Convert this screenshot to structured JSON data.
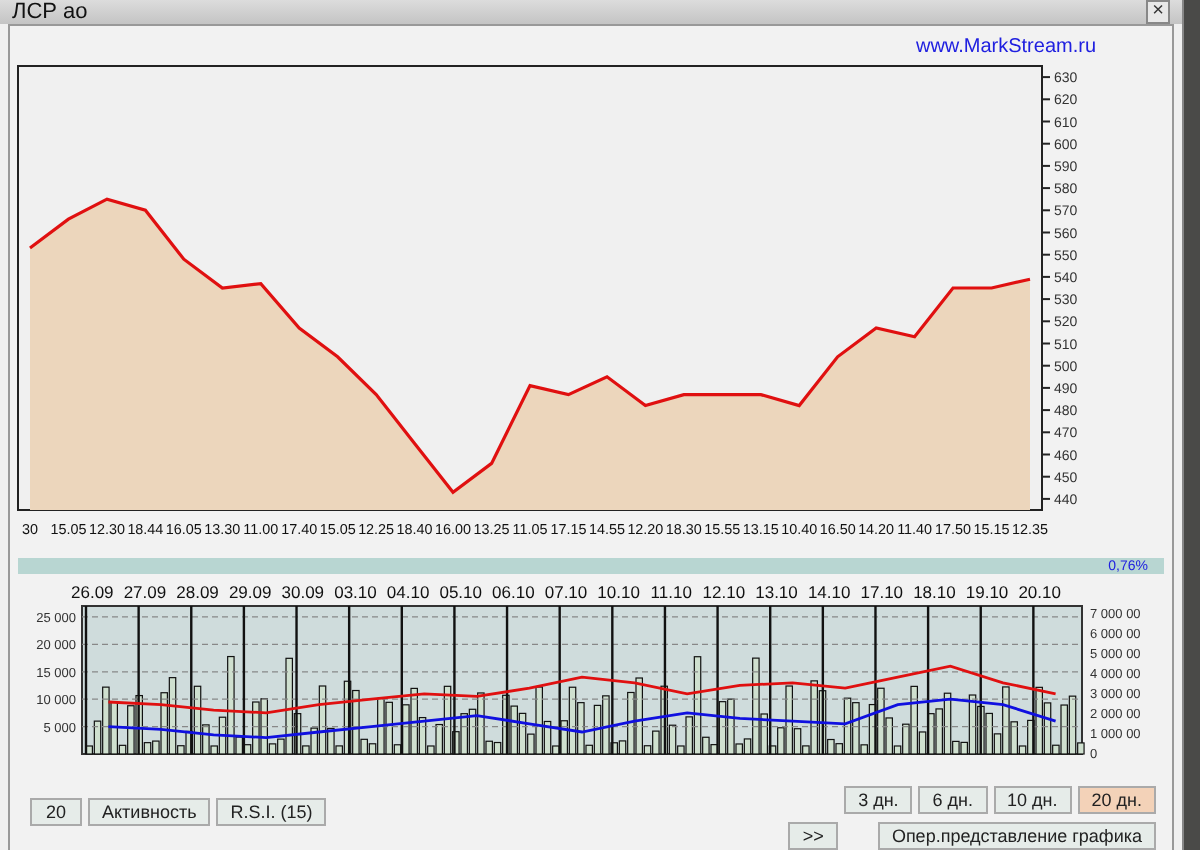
{
  "window": {
    "title": "ЛСР ао",
    "close": "×"
  },
  "link": "www.MarkStream.ru",
  "price_chart": {
    "chart_data": {
      "type": "area",
      "categories": [
        "30",
        "15.05",
        "12.30",
        "18.44",
        "16.05",
        "13.30",
        "11.00",
        "17.40",
        "15.05",
        "12.25",
        "18.40",
        "16.00",
        "13.25",
        "11.05",
        "17.15",
        "14.55",
        "12.20",
        "18.30",
        "15.55",
        "13.15",
        "10.40",
        "16.50",
        "14.20",
        "11.40",
        "17.50",
        "15.15",
        "12.35"
      ],
      "series": [
        {
          "color": "#e01010",
          "values": [
            553,
            566,
            575,
            570,
            548,
            535,
            537,
            517,
            504,
            487,
            465,
            443,
            456,
            491,
            487,
            495,
            482,
            487,
            487,
            487,
            482,
            504,
            517,
            513,
            535,
            535,
            539
          ]
        }
      ],
      "ylim": [
        435,
        635
      ],
      "yticks": [
        440,
        450,
        460,
        470,
        480,
        490,
        500,
        510,
        520,
        530,
        540,
        550,
        560,
        570,
        580,
        590,
        600,
        610,
        620,
        630
      ]
    }
  },
  "change": "0,76%",
  "activity_chart": {
    "chart_data": {
      "type": "line",
      "categories": [
        "26.09",
        "27.09",
        "28.09",
        "29.09",
        "30.09",
        "03.10",
        "04.10",
        "05.10",
        "06.10",
        "07.10",
        "10.10",
        "11.10",
        "12.10",
        "13.10",
        "14.10",
        "17.10",
        "18.10",
        "19.10",
        "20.10"
      ],
      "series": [
        {
          "color": "#e01010",
          "values": [
            9500,
            9000,
            8000,
            7500,
            9000,
            10000,
            11000,
            10500,
            12000,
            14000,
            13000,
            11000,
            12500,
            13000,
            12000,
            14000,
            16000,
            13000,
            11000
          ]
        },
        {
          "color": "#1010e0",
          "values": [
            5000,
            4500,
            3500,
            3000,
            4000,
            5000,
            6000,
            7000,
            5500,
            4000,
            6000,
            7500,
            6500,
            6000,
            5500,
            9000,
            10000,
            9000,
            6000
          ]
        }
      ],
      "ylim": [
        0,
        27000
      ],
      "grid": true,
      "yticks": [
        {
          "value": 5000,
          "label": "5 000"
        },
        {
          "value": 10000,
          "label": "10 000"
        },
        {
          "value": 15000,
          "label": "15 000"
        },
        {
          "value": 20000,
          "label": "20 000"
        },
        {
          "value": 25000,
          "label": "25 000"
        }
      ]
    },
    "right_axis_labels": [
      "7 000 00",
      "6 000 00",
      "5 000 00",
      "4 000 00",
      "3 000 00",
      "2 000 00",
      "1 000 00",
      "0"
    ]
  },
  "left_buttons": [
    "20",
    "Активность",
    "R.S.I.  (15)"
  ],
  "periods": [
    {
      "label": "3 дн.",
      "selected": false
    },
    {
      "label": "6 дн.",
      "selected": false
    },
    {
      "label": "10 дн.",
      "selected": false
    },
    {
      "label": "20 дн.",
      "selected": true
    }
  ],
  "next_button": ">>",
  "view_button": "Опер.представление графика"
}
